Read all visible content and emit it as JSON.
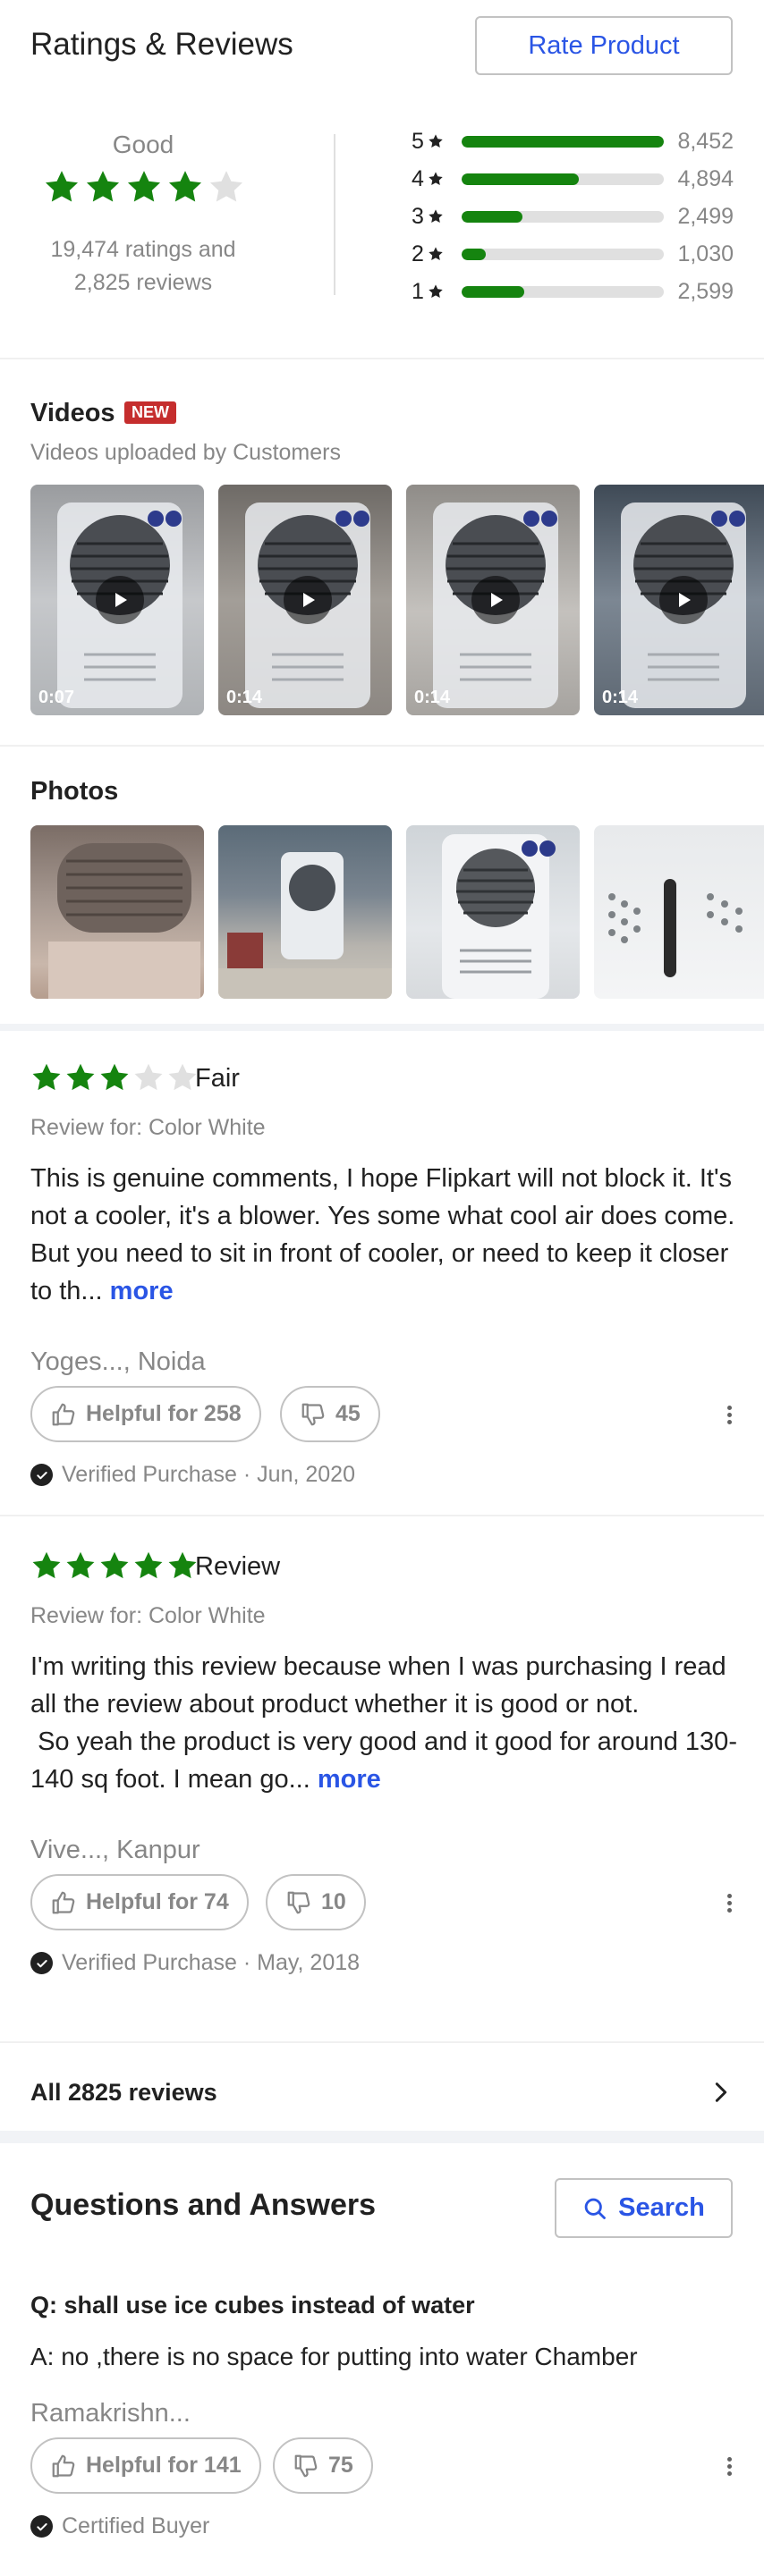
{
  "ratings": {
    "title": "Ratings & Reviews",
    "rate_button": "Rate Product",
    "label": "Good",
    "average_stars": 4,
    "count_line1": "19,474 ratings and",
    "count_line2": "2,825 reviews",
    "bars": [
      {
        "star": "5",
        "count": "8,452",
        "fraction": 1.0
      },
      {
        "star": "4",
        "count": "4,894",
        "fraction": 0.58
      },
      {
        "star": "3",
        "count": "2,499",
        "fraction": 0.3
      },
      {
        "star": "2",
        "count": "1,030",
        "fraction": 0.12
      },
      {
        "star": "1",
        "count": "2,599",
        "fraction": 0.31
      }
    ],
    "colors": {
      "green": "#15840f",
      "track": "#e0e0e0",
      "link": "#2a55e5"
    }
  },
  "videos": {
    "title": "Videos",
    "badge": "NEW",
    "subtitle": "Videos uploaded by Customers",
    "items": [
      {
        "duration": "0:07",
        "icon": "play-icon"
      },
      {
        "duration": "0:14",
        "icon": "play-icon"
      },
      {
        "duration": "0:14",
        "icon": "play-icon"
      },
      {
        "duration": "0:14",
        "icon": "play-icon"
      }
    ]
  },
  "photos": {
    "title": "Photos"
  },
  "reviews": [
    {
      "stars": 3,
      "heading": "Fair",
      "review_for": "Review for: Color White",
      "body": "This is genuine comments, I hope Flipkart will not block it. It's not a cooler, it's a blower. Yes some what cool air does come. But you need to sit in front of cooler, or need to keep it closer to th... ",
      "more": "more",
      "author": "Yoges..., Noida",
      "helpful": "Helpful for 258",
      "dislikes": "45",
      "verified": "Verified Purchase · Jun, 2020"
    },
    {
      "stars": 5,
      "heading": "Review",
      "review_for": "Review for: Color White",
      "body": "I'm writing this review because when I was purchasing I read all the review about product whether it is good or not.\n So yeah the product is very good and it good for around 130-140 sq foot. I mean go... ",
      "more": "more",
      "author": "Vive..., Kanpur",
      "helpful": "Helpful for 74",
      "dislikes": "10",
      "verified": "Verified Purchase · May, 2018"
    }
  ],
  "all_reviews": "All 2825 reviews",
  "qa": {
    "title": "Questions and Answers",
    "search_button": "Search",
    "question": "Q: shall use ice cubes instead of water",
    "answer": "A: no ,there is no space for  putting into water Chamber",
    "author": "Ramakrishn...",
    "helpful": "Helpful for 141",
    "dislikes": "75",
    "certified": "Certified Buyer"
  }
}
